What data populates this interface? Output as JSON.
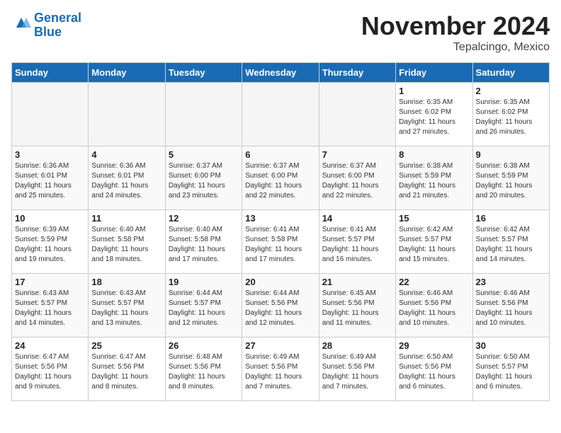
{
  "header": {
    "logo_line1": "General",
    "logo_line2": "Blue",
    "month_title": "November 2024",
    "location": "Tepalcingo, Mexico"
  },
  "weekdays": [
    "Sunday",
    "Monday",
    "Tuesday",
    "Wednesday",
    "Thursday",
    "Friday",
    "Saturday"
  ],
  "weeks": [
    [
      {
        "day": "",
        "info": ""
      },
      {
        "day": "",
        "info": ""
      },
      {
        "day": "",
        "info": ""
      },
      {
        "day": "",
        "info": ""
      },
      {
        "day": "",
        "info": ""
      },
      {
        "day": "1",
        "info": "Sunrise: 6:35 AM\nSunset: 6:02 PM\nDaylight: 11 hours\nand 27 minutes."
      },
      {
        "day": "2",
        "info": "Sunrise: 6:35 AM\nSunset: 6:02 PM\nDaylight: 11 hours\nand 26 minutes."
      }
    ],
    [
      {
        "day": "3",
        "info": "Sunrise: 6:36 AM\nSunset: 6:01 PM\nDaylight: 11 hours\nand 25 minutes."
      },
      {
        "day": "4",
        "info": "Sunrise: 6:36 AM\nSunset: 6:01 PM\nDaylight: 11 hours\nand 24 minutes."
      },
      {
        "day": "5",
        "info": "Sunrise: 6:37 AM\nSunset: 6:00 PM\nDaylight: 11 hours\nand 23 minutes."
      },
      {
        "day": "6",
        "info": "Sunrise: 6:37 AM\nSunset: 6:00 PM\nDaylight: 11 hours\nand 22 minutes."
      },
      {
        "day": "7",
        "info": "Sunrise: 6:37 AM\nSunset: 6:00 PM\nDaylight: 11 hours\nand 22 minutes."
      },
      {
        "day": "8",
        "info": "Sunrise: 6:38 AM\nSunset: 5:59 PM\nDaylight: 11 hours\nand 21 minutes."
      },
      {
        "day": "9",
        "info": "Sunrise: 6:38 AM\nSunset: 5:59 PM\nDaylight: 11 hours\nand 20 minutes."
      }
    ],
    [
      {
        "day": "10",
        "info": "Sunrise: 6:39 AM\nSunset: 5:59 PM\nDaylight: 11 hours\nand 19 minutes."
      },
      {
        "day": "11",
        "info": "Sunrise: 6:40 AM\nSunset: 5:58 PM\nDaylight: 11 hours\nand 18 minutes."
      },
      {
        "day": "12",
        "info": "Sunrise: 6:40 AM\nSunset: 5:58 PM\nDaylight: 11 hours\nand 17 minutes."
      },
      {
        "day": "13",
        "info": "Sunrise: 6:41 AM\nSunset: 5:58 PM\nDaylight: 11 hours\nand 17 minutes."
      },
      {
        "day": "14",
        "info": "Sunrise: 6:41 AM\nSunset: 5:57 PM\nDaylight: 11 hours\nand 16 minutes."
      },
      {
        "day": "15",
        "info": "Sunrise: 6:42 AM\nSunset: 5:57 PM\nDaylight: 11 hours\nand 15 minutes."
      },
      {
        "day": "16",
        "info": "Sunrise: 6:42 AM\nSunset: 5:57 PM\nDaylight: 11 hours\nand 14 minutes."
      }
    ],
    [
      {
        "day": "17",
        "info": "Sunrise: 6:43 AM\nSunset: 5:57 PM\nDaylight: 11 hours\nand 14 minutes."
      },
      {
        "day": "18",
        "info": "Sunrise: 6:43 AM\nSunset: 5:57 PM\nDaylight: 11 hours\nand 13 minutes."
      },
      {
        "day": "19",
        "info": "Sunrise: 6:44 AM\nSunset: 5:57 PM\nDaylight: 11 hours\nand 12 minutes."
      },
      {
        "day": "20",
        "info": "Sunrise: 6:44 AM\nSunset: 5:56 PM\nDaylight: 11 hours\nand 12 minutes."
      },
      {
        "day": "21",
        "info": "Sunrise: 6:45 AM\nSunset: 5:56 PM\nDaylight: 11 hours\nand 11 minutes."
      },
      {
        "day": "22",
        "info": "Sunrise: 6:46 AM\nSunset: 5:56 PM\nDaylight: 11 hours\nand 10 minutes."
      },
      {
        "day": "23",
        "info": "Sunrise: 6:46 AM\nSunset: 5:56 PM\nDaylight: 11 hours\nand 10 minutes."
      }
    ],
    [
      {
        "day": "24",
        "info": "Sunrise: 6:47 AM\nSunset: 5:56 PM\nDaylight: 11 hours\nand 9 minutes."
      },
      {
        "day": "25",
        "info": "Sunrise: 6:47 AM\nSunset: 5:56 PM\nDaylight: 11 hours\nand 8 minutes."
      },
      {
        "day": "26",
        "info": "Sunrise: 6:48 AM\nSunset: 5:56 PM\nDaylight: 11 hours\nand 8 minutes."
      },
      {
        "day": "27",
        "info": "Sunrise: 6:49 AM\nSunset: 5:56 PM\nDaylight: 11 hours\nand 7 minutes."
      },
      {
        "day": "28",
        "info": "Sunrise: 6:49 AM\nSunset: 5:56 PM\nDaylight: 11 hours\nand 7 minutes."
      },
      {
        "day": "29",
        "info": "Sunrise: 6:50 AM\nSunset: 5:56 PM\nDaylight: 11 hours\nand 6 minutes."
      },
      {
        "day": "30",
        "info": "Sunrise: 6:50 AM\nSunset: 5:57 PM\nDaylight: 11 hours\nand 6 minutes."
      }
    ]
  ]
}
